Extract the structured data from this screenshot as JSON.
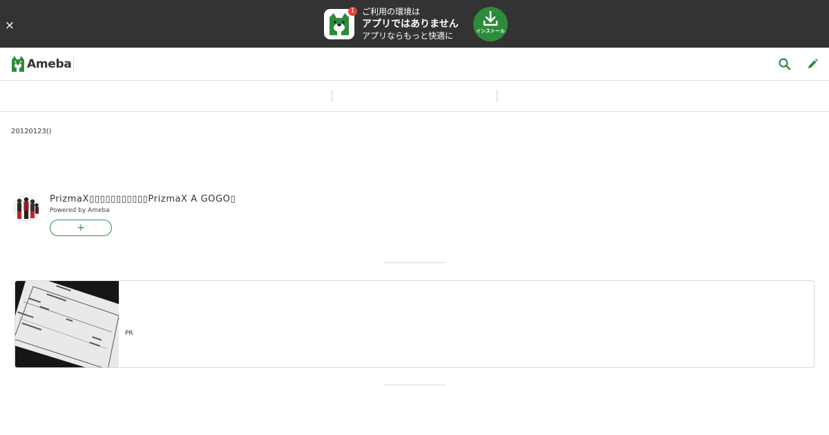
{
  "banner": {
    "close_label": "×",
    "notification_count": "1",
    "line1": "ご利用の環境は",
    "line2": "アプリではありません",
    "line3": "アプリならもっと快適に",
    "install_label": "インストール",
    "app_icon": "ameba-app-icon",
    "install_icon": "download-icon",
    "accent_color": "#2d8c3c",
    "background_color": "#333333"
  },
  "header": {
    "logo_text": "Ameba",
    "logo_icon": "ameba-dog-icon",
    "search_icon": "search-icon",
    "edit_icon": "pencil-icon"
  },
  "entry": {
    "date": "20120123()"
  },
  "blog": {
    "title": "PrizmaX▯▯▯▯▯▯▯▯▯▯▯PrizmaX A GOGO▯",
    "powered_by": "Powered by Ameba",
    "follow_label": "+"
  },
  "pr": {
    "label": "PR"
  }
}
